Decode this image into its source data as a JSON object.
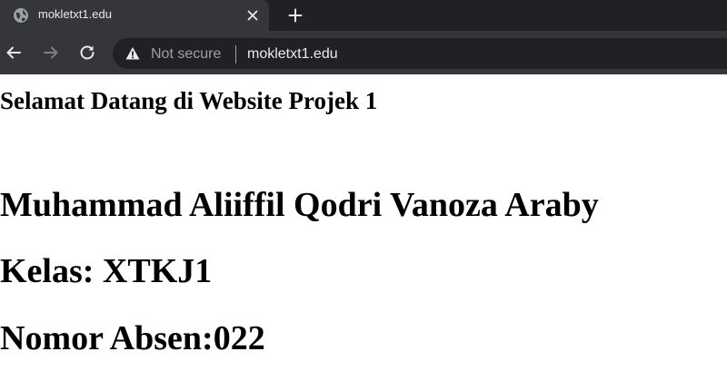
{
  "browser": {
    "tab": {
      "title": "mokletxt1.edu",
      "favicon_icon": "globe-icon",
      "close_icon": "close-icon"
    },
    "new_tab_icon": "plus-icon",
    "nav": {
      "back_icon": "arrow-back-icon",
      "forward_icon": "arrow-forward-icon",
      "reload_icon": "reload-icon"
    },
    "omnibox": {
      "security_icon": "warning-icon",
      "security_label": "Not secure",
      "url": "mokletxt1.edu"
    },
    "colors": {
      "tabstrip": "#202124",
      "toolbar": "#35363a",
      "text": "#e8eaed",
      "muted": "#9aa0a6"
    }
  },
  "page": {
    "welcome_heading": "Selamat Datang di Website Projek 1",
    "student_name": "Muhammad Aliiffil Qodri Vanoza Araby",
    "class_line": "Kelas: XTKJ1",
    "attendance_line": "Nomor Absen:022"
  }
}
